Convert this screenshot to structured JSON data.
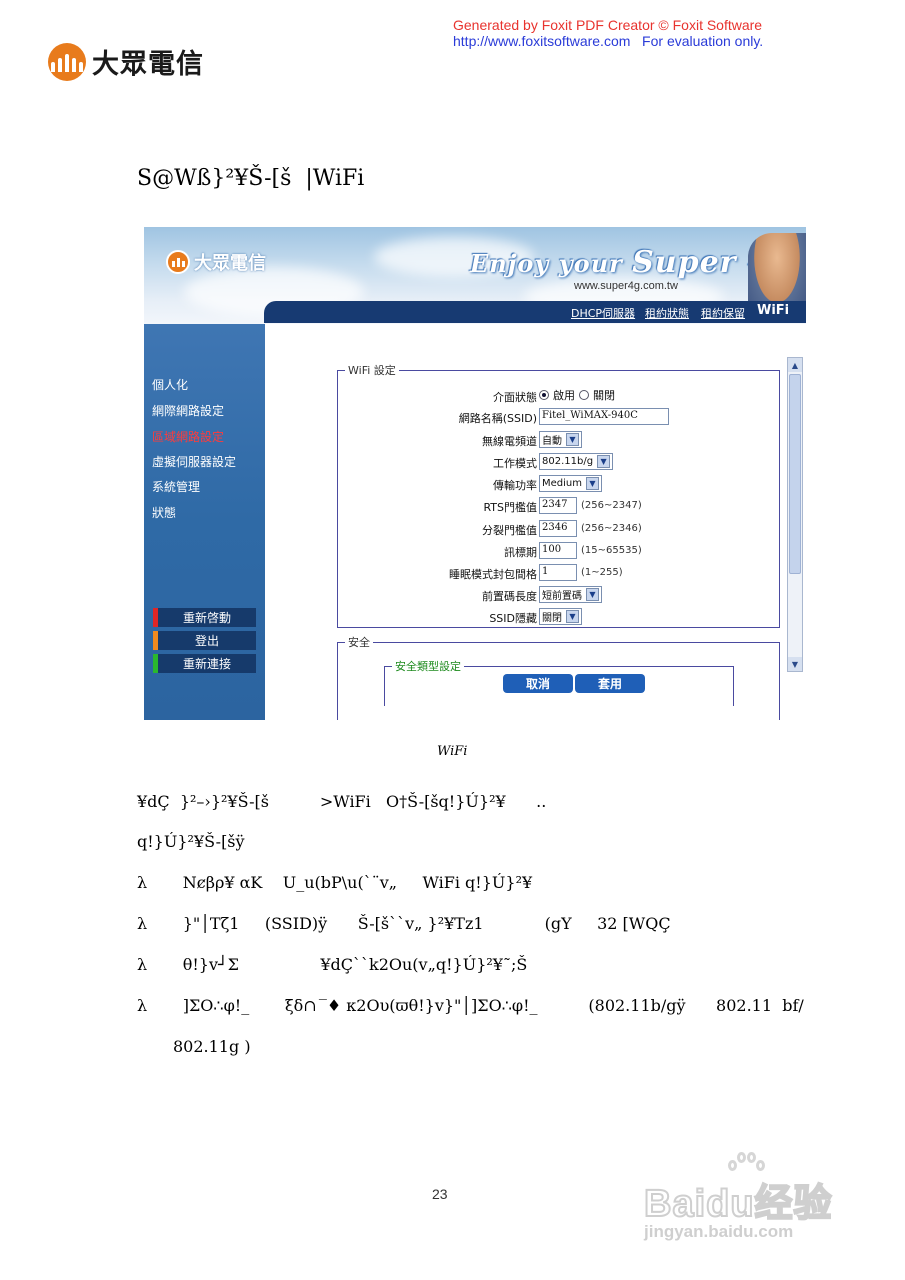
{
  "watermark_header": {
    "line1": "Generated by Foxit PDF Creator © Foxit Software",
    "line2": "http://www.foxitsoftware.com   For evaluation only."
  },
  "brand": {
    "name": "大眾電信"
  },
  "heading": "S@Wß}²¥Š-[š  |WiFi",
  "screenshot": {
    "banner_brand": "大眾電信",
    "slogan_pre": "Enjoy your ",
    "slogan_big": "Super 4G",
    "url": "www.super4g.com.tw",
    "nav": [
      "DHCP伺服器",
      "租約狀態",
      "租約保留",
      "WiFi"
    ],
    "sidebar": [
      "個人化",
      "網際網路設定",
      "區域網路設定",
      "虛擬伺服器設定",
      "系統管理",
      "狀態"
    ],
    "sidebar_buttons": [
      "重新啓動",
      "登出",
      "重新連接"
    ],
    "wifi_legend": "WiFi 設定",
    "rows": {
      "iface_label": "介面狀態",
      "iface_on": "啟用",
      "iface_off": "關閉",
      "ssid_label": "網路名稱(SSID)",
      "ssid_value": "Fitel_WiMAX-940C",
      "channel_label": "無線電頻道",
      "channel_value": "自動",
      "mode_label": "工作模式",
      "mode_value": "802.11b/g",
      "power_label": "傳輸功率",
      "power_value": "Medium",
      "rts_label": "RTS門檻值",
      "rts_value": "2347",
      "rts_hint": "(256~2347)",
      "frag_label": "分裂門檻值",
      "frag_value": "2346",
      "frag_hint": "(256~2346)",
      "beacon_label": "訊標期",
      "beacon_value": "100",
      "beacon_hint": "(15~65535)",
      "dtim_label": "睡眠模式封包間格",
      "dtim_value": "1",
      "dtim_hint": "(1~255)",
      "preamble_label": "前置碼長度",
      "preamble_value": "短前置碼",
      "hide_label": "SSID隱藏",
      "hide_value": "關閉"
    },
    "security_legend": "安全",
    "security_type_legend": "安全類型設定",
    "cancel": "取消",
    "apply": "套用"
  },
  "caption": "WiFi",
  "paragraphs": {
    "p1": "¥dÇ  }²–›}²¥Š-[š          >WiFi   O†Š-[šq!}Ú}²¥      ..",
    "p2": "q!}Ú}²¥Š-[šÿ"
  },
  "bullets": [
    "λ       Nȼβρ¥ αK    U_u(bP\\u(`¨v„     WiFi q!}Ú}²¥",
    "λ       }\"│Tζ1     (SSID)ÿ      Š-[š``v„ }²¥Tz1            (gY     32 [WQÇ",
    "λ       θ!}v┘Σ                ¥dÇ``k2Ou(v„q!}Ú}²¥˜;Š",
    "λ       ]ΣO∴φ!_       ξδ∩  ̅♦ κ2Oυ(ϖθ!}v}\"│]ΣO∴φ!_          (802.11b/gÿ      802.11  bf/"
  ],
  "bullet_cont": "802.11g )",
  "page_number": "23",
  "watermark": {
    "brand": "Baidu经验",
    "sub": "jingyan.baidu.com"
  }
}
